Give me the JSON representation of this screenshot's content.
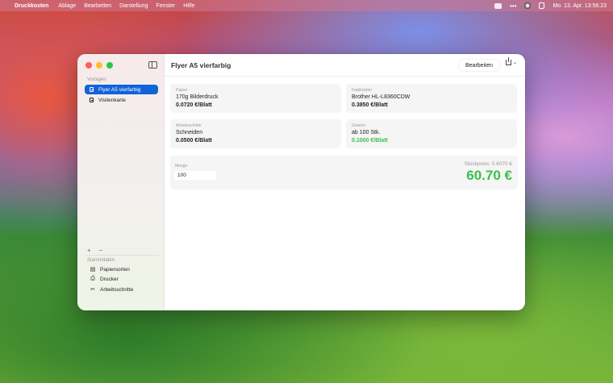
{
  "menubar": {
    "app_name": "Druckkosten",
    "items": [
      "Ablage",
      "Bearbeiten",
      "Darstellung",
      "Fenster",
      "Hilfe"
    ],
    "clock": "Mo. 13. Apr.  13:56:23"
  },
  "window": {
    "title": "Flyer A5 vierfarbig",
    "edit_label": "Bearbeiten"
  },
  "sidebar": {
    "templates_header": "Vorlagen",
    "templates": [
      {
        "label": "Flyer A5 vierfarbig",
        "selected": true
      },
      {
        "label": "Visitenkarte",
        "selected": false
      }
    ],
    "add_symbol": "+",
    "remove_symbol": "−",
    "master_header": "Stammdaten",
    "master_items": [
      {
        "label": "Papiersorten",
        "icon": "paper-stack-icon"
      },
      {
        "label": "Drucker",
        "icon": "printer-icon"
      },
      {
        "label": "Arbeitsschritte",
        "icon": "scissors-icon"
      }
    ]
  },
  "cards": {
    "paper": {
      "label": "Papier",
      "name": "170g Bilderdruck",
      "price": "0.0720 €/Blatt"
    },
    "color": {
      "label": "Farbkosten",
      "name": "Brother HL-L8360CDW",
      "price": "0.3850 €/Blatt"
    },
    "steps": {
      "label": "Arbeitsschritte",
      "name": "Schneiden",
      "price": "0.0500 €/Blatt"
    },
    "profit": {
      "label": "Gewinn",
      "name": "ab 100 Stk.",
      "price": "0.1000 €/Blatt"
    }
  },
  "quantity": {
    "label": "Menge",
    "value": "100",
    "unit_price": "Stückpreis: 0.6070 €",
    "total": "60.70 €"
  },
  "colors": {
    "accent_blue": "#1163d9",
    "profit_green": "#38c04a"
  }
}
